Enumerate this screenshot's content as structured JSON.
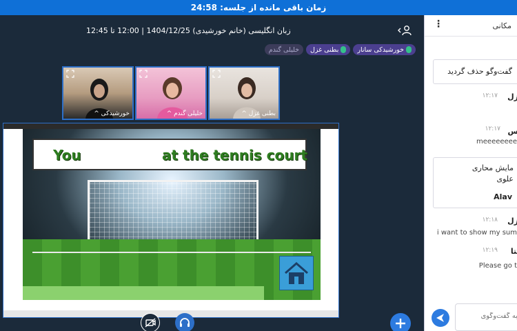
{
  "session_timer": "زمان باقی مانده از جلسه: 24:58",
  "meeting": {
    "title": "زبان انگلیسی (خانم خورشیدی) 1404/12/25 | 12:00 تا 12:45"
  },
  "talkers": [
    {
      "name": "خورشیدکی سانار",
      "muted": false
    },
    {
      "name": "بطنی غزل",
      "muted": false
    },
    {
      "name": "خلیلی گندم",
      "muted": true
    }
  ],
  "webcams": [
    {
      "label": "خورشیدکی ^"
    },
    {
      "label": "خلیلی گندم ^"
    },
    {
      "label": "بطنی غزل ^"
    }
  ],
  "slide": {
    "word_left": "You",
    "word_right": "at the tennis court"
  },
  "chat": {
    "header": "مکانی",
    "system_message": "گفت‌وگو حذف گردید",
    "messages": [
      {
        "sender": "غزل",
        "time": "۱۲:۱۷",
        "text": ""
      },
      {
        "sender": "باس",
        "time": "۱۲:۱۷",
        "text": "meeeeeeee"
      },
      {
        "sender": "غزل",
        "time": "۱۲:۱۸",
        "text": "i want to show my sum"
      },
      {
        "sender": "بکتا",
        "time": "۱۲:۱۹",
        "text": "Please go t"
      }
    ],
    "poll": {
      "line1": "مایش محاری",
      "line2": "علوی",
      "line3": "Alav"
    },
    "input_placeholder": "به گفت‌وگوی"
  },
  "colors": {
    "topbar": "#0f70d7",
    "main_bg": "#1b2a3a",
    "accent": "#2d7be0",
    "slide_text": "#2e7d20"
  }
}
